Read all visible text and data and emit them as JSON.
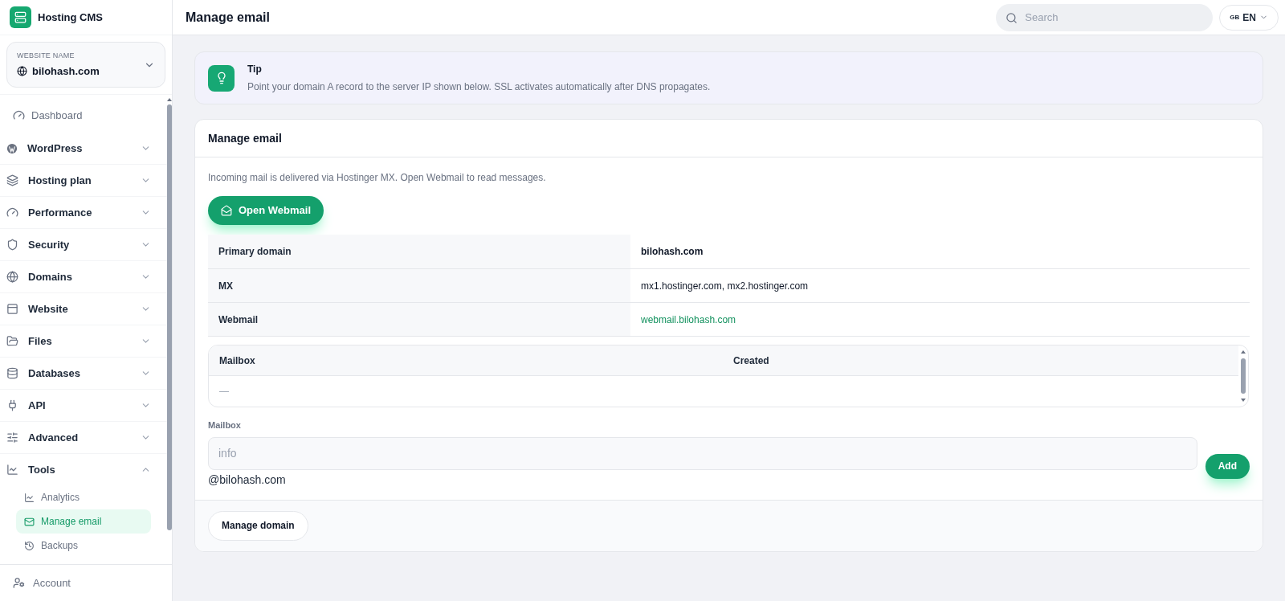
{
  "brand": {
    "name": "Hosting CMS"
  },
  "website": {
    "label": "WEBSITE NAME",
    "name": "bilohash.com"
  },
  "nav": [
    {
      "kind": "link",
      "label": "Dashboard"
    },
    {
      "kind": "group",
      "label": "WordPress",
      "expanded": false
    },
    {
      "kind": "group",
      "label": "Hosting plan",
      "expanded": false
    },
    {
      "kind": "group",
      "label": "Performance",
      "expanded": false
    },
    {
      "kind": "group",
      "label": "Security",
      "expanded": false
    },
    {
      "kind": "group",
      "label": "Domains",
      "expanded": false
    },
    {
      "kind": "group",
      "label": "Website",
      "expanded": false
    },
    {
      "kind": "group",
      "label": "Files",
      "expanded": false
    },
    {
      "kind": "group",
      "label": "Databases",
      "expanded": false
    },
    {
      "kind": "group",
      "label": "API",
      "expanded": false
    },
    {
      "kind": "group",
      "label": "Advanced",
      "expanded": false
    },
    {
      "kind": "group",
      "label": "Tools",
      "expanded": true,
      "children": [
        {
          "label": "Analytics",
          "selected": false
        },
        {
          "label": "Manage email",
          "selected": true
        },
        {
          "label": "Backups",
          "selected": false
        }
      ]
    }
  ],
  "account": {
    "label": "Account"
  },
  "header": {
    "title": "Manage email",
    "search_placeholder": "Search",
    "language": {
      "flag": "GB",
      "code": "EN"
    }
  },
  "tip": {
    "title": "Tip",
    "text": "Point your domain A record to the server IP shown below. SSL activates automatically after DNS propagates."
  },
  "card": {
    "title": "Manage email",
    "intro": "Incoming mail is delivered via Hostinger MX. Open Webmail to read messages.",
    "open_button": "Open Webmail",
    "details": [
      {
        "kind": "bold",
        "label": "Primary domain",
        "value": "bilohash.com"
      },
      {
        "kind": "plain",
        "label": "MX",
        "value": "mx1.hostinger.com, mx2.hostinger.com"
      },
      {
        "kind": "link",
        "label": "Webmail",
        "value": "webmail.bilohash.com"
      }
    ],
    "mailboxes": {
      "columns": [
        "Mailbox",
        "Created"
      ],
      "rows": [
        [
          "—"
        ]
      ]
    },
    "form": {
      "label": "Mailbox",
      "placeholder": "info",
      "suffix": "@bilohash.com",
      "add_button": "Add"
    },
    "footer_button": "Manage domain"
  }
}
